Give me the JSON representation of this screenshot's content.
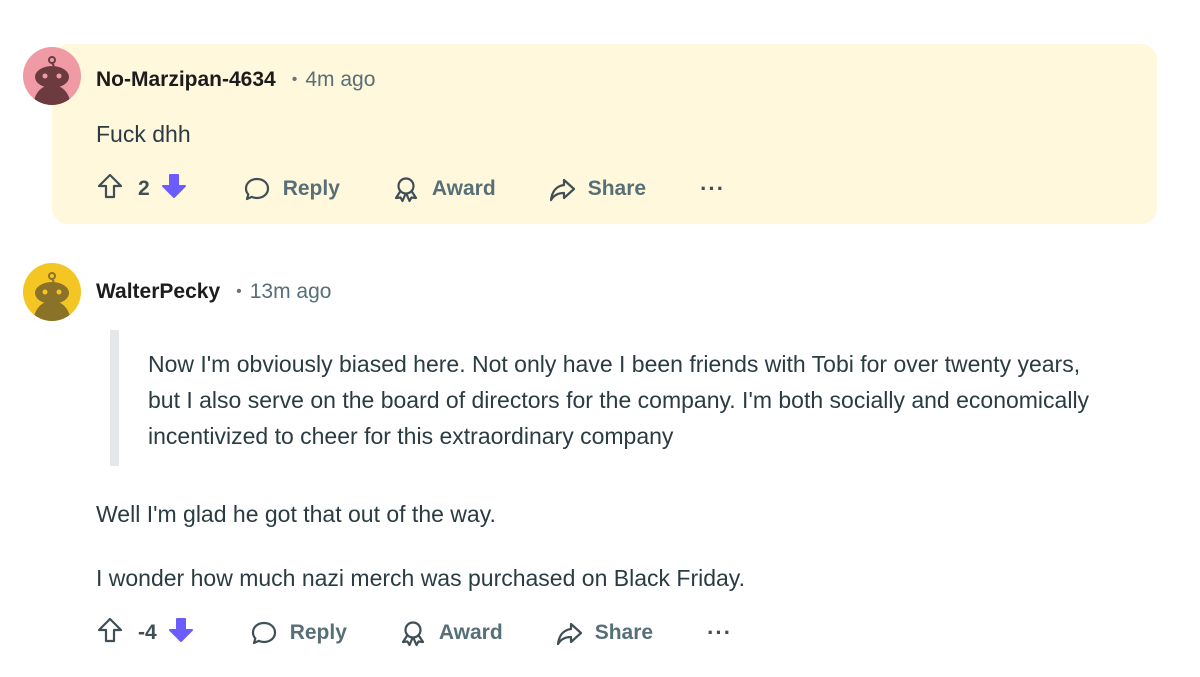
{
  "comments": [
    {
      "author": "No-Marzipan-4634",
      "separator": "•",
      "time": "4m ago",
      "body": "Fuck dhh",
      "score": "2",
      "actions": {
        "reply": "Reply",
        "award": "Award",
        "share": "Share",
        "more": "···"
      },
      "highlighted": true,
      "avatar_color": "#ef9aa5"
    },
    {
      "author": "WalterPecky",
      "separator": "•",
      "time": "13m ago",
      "quote": "Now I'm obviously biased here. Not only have I been friends with Tobi for over twenty years, but I also serve on the board of directors for the company. I'm both socially and economically incentivized to cheer for this extraordinary company",
      "paragraphs": [
        "Well I'm glad he got that out of the way.",
        "I wonder how much nazi merch was purchased on Black Friday."
      ],
      "score": "-4",
      "actions": {
        "reply": "Reply",
        "award": "Award",
        "share": "Share",
        "more": "···"
      },
      "highlighted": false,
      "avatar_color": "#f3c623"
    }
  ],
  "colors": {
    "highlight_bg": "#fff8dc",
    "downvote_active": "#6a5cff",
    "quote_bar": "#e5e7e8",
    "muted_text": "#576f76"
  }
}
